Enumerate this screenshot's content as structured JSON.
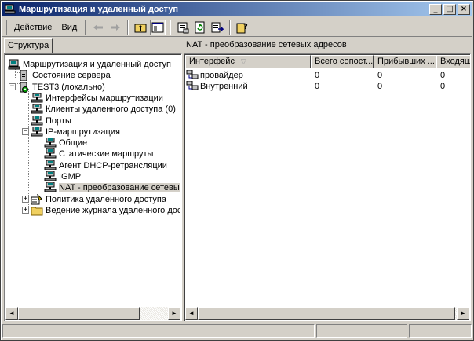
{
  "window": {
    "title": "Маршрутизация и удаленный доступ",
    "caption_buttons": {
      "minimize": "_",
      "maximize": "□",
      "close": "×"
    }
  },
  "toolbar": {
    "menu": [
      {
        "label_pre": "",
        "label_u": "Д",
        "label_post": "ействие"
      },
      {
        "label_pre": "",
        "label_u": "В",
        "label_post": "ид"
      }
    ],
    "buttons": [
      {
        "icon": "back-arrow-icon",
        "enabled": false
      },
      {
        "icon": "forward-arrow-icon",
        "enabled": false
      },
      {
        "icon": "up-folder-icon",
        "enabled": true
      },
      {
        "icon": "show-hide-tree-icon",
        "enabled": true,
        "pressed": true
      },
      {
        "icon": "properties-icon",
        "enabled": true
      },
      {
        "icon": "refresh-icon",
        "enabled": true
      },
      {
        "icon": "export-list-icon",
        "enabled": true
      },
      {
        "icon": "help-icon",
        "enabled": true
      }
    ]
  },
  "left_pane": {
    "tab_label": "Структура",
    "tree": [
      {
        "label": "Маршрутизация и удаленный доступ",
        "icon": "rras-root-icon",
        "level": 0
      },
      {
        "label": "Состояние сервера",
        "icon": "server-status-icon",
        "level": 1
      },
      {
        "label": "TEST3 (локально)",
        "icon": "server-icon",
        "level": 1,
        "expander": "−"
      },
      {
        "label": "Интерфейсы маршрутизации",
        "icon": "network-interface-icon",
        "level": 2
      },
      {
        "label": "Клиенты удаленного доступа (0)",
        "icon": "network-interface-icon",
        "level": 2
      },
      {
        "label": "Порты",
        "icon": "network-interface-icon",
        "level": 2
      },
      {
        "label": "IP-маршрутизация",
        "icon": "network-interface-icon",
        "level": 2,
        "expander": "−"
      },
      {
        "label": "Общие",
        "icon": "network-interface-icon",
        "level": 3
      },
      {
        "label": "Статические маршруты",
        "icon": "network-interface-icon",
        "level": 3
      },
      {
        "label": "Агент DHCP-ретрансляции",
        "icon": "network-interface-icon",
        "level": 3
      },
      {
        "label": "IGMP",
        "icon": "network-interface-icon",
        "level": 3
      },
      {
        "label": "NAT - преобразование сетевых а",
        "icon": "network-interface-icon",
        "level": 3,
        "selected": true
      },
      {
        "label": "Политика удаленного доступа",
        "icon": "policy-icon",
        "level": 2,
        "expander": "+"
      },
      {
        "label": "Ведение журнала удаленного достуг",
        "icon": "folder-icon",
        "level": 2,
        "expander": "+"
      }
    ],
    "scroll": {
      "left": "◄",
      "right": "►"
    }
  },
  "right_pane": {
    "header": "NAT - преобразование сетевых адресов",
    "columns": [
      "Интерфейс",
      "Всего сопост...",
      "Прибывших ...",
      "Входящ"
    ],
    "sort_indicator": "▽",
    "rows": [
      {
        "name": "провайдер",
        "total": "0",
        "inbound": "0",
        "incoming": "0",
        "icon": "nat-interface-icon"
      },
      {
        "name": "Внутренний",
        "total": "0",
        "inbound": "0",
        "incoming": "0",
        "icon": "nat-interface-icon"
      }
    ],
    "scroll": {
      "left": "◄",
      "right": "►"
    }
  },
  "colors": {
    "title_gradient_start": "#0a246a",
    "title_gradient_end": "#a6caf0",
    "face": "#d4d0c8"
  }
}
